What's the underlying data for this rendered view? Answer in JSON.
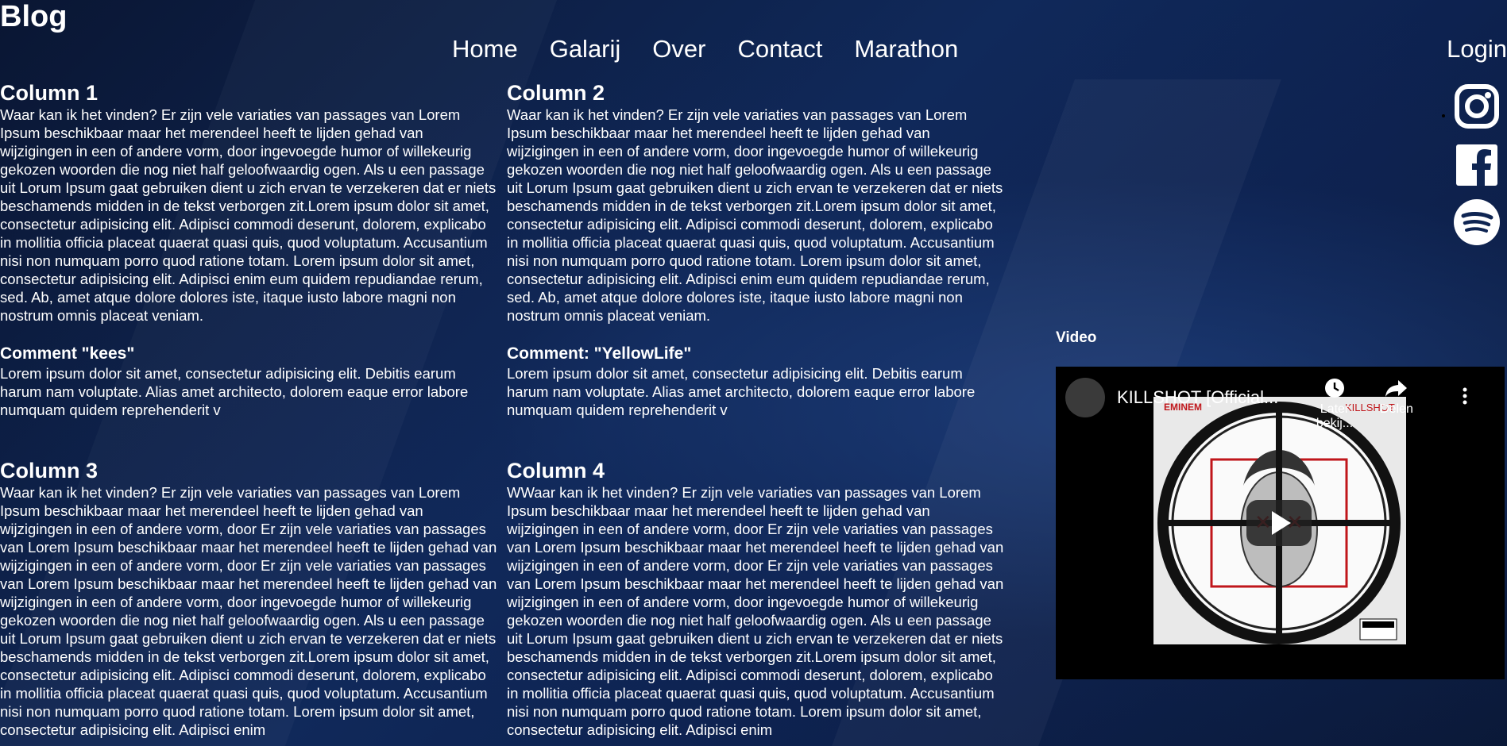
{
  "header": {
    "site_title": "Blog",
    "nav": [
      "Home",
      "Galarij",
      "Over",
      "Contact",
      "Marathon"
    ],
    "login": "Login"
  },
  "social": [
    {
      "icon": "instagram-icon"
    },
    {
      "icon": "facebook-icon"
    },
    {
      "icon": "spotify-icon"
    }
  ],
  "columns": [
    {
      "title": "Column 1",
      "text": "Waar kan ik het vinden? Er zijn vele variaties van passages van Lorem Ipsum beschikbaar maar het merendeel heeft te lijden gehad van wijzigingen in een of andere vorm, door ingevoegde humor of willekeurig gekozen woorden die nog niet half geloofwaardig ogen. Als u een passage uit Lorum Ipsum gaat gebruiken dient u zich ervan te verzekeren dat er niets beschamends midden in de tekst verborgen zit.Lorem ipsum dolor sit amet, consectetur adipisicing elit. Adipisci commodi deserunt, dolorem, explicabo in mollitia officia placeat quaerat quasi quis, quod voluptatum. Accusantium nisi non numquam porro quod ratione totam. Lorem ipsum dolor sit amet, consectetur adipisicing elit. Adipisci enim eum quidem repudiandae rerum, sed. Ab, amet atque dolore dolores iste, itaque iusto labore magni non nostrum omnis placeat veniam.",
      "comment_title": "Comment \"kees\"",
      "comment_text": "Lorem ipsum dolor sit amet, consectetur adipisicing elit. Debitis earum harum nam voluptate. Alias amet architecto, dolorem eaque error labore numquam quidem reprehenderit v"
    },
    {
      "title": "Column 2",
      "text": "Waar kan ik het vinden? Er zijn vele variaties van passages van Lorem Ipsum beschikbaar maar het merendeel heeft te lijden gehad van wijzigingen in een of andere vorm, door ingevoegde humor of willekeurig gekozen woorden die nog niet half geloofwaardig ogen. Als u een passage uit Lorum Ipsum gaat gebruiken dient u zich ervan te verzekeren dat er niets beschamends midden in de tekst verborgen zit.Lorem ipsum dolor sit amet, consectetur adipisicing elit. Adipisci commodi deserunt, dolorem, explicabo in mollitia officia placeat quaerat quasi quis, quod voluptatum. Accusantium nisi non numquam porro quod ratione totam. Lorem ipsum dolor sit amet, consectetur adipisicing elit. Adipisci enim eum quidem repudiandae rerum, sed. Ab, amet atque dolore dolores iste, itaque iusto labore magni non nostrum omnis placeat veniam.",
      "comment_title": "Comment: \"YellowLife\"",
      "comment_text": "Lorem ipsum dolor sit amet, consectetur adipisicing elit. Debitis earum harum nam voluptate. Alias amet architecto, dolorem eaque error labore numquam quidem reprehenderit v"
    },
    {
      "title": "Column 3",
      "text": "Waar kan ik het vinden? Er zijn vele variaties van passages van Lorem Ipsum beschikbaar maar het merendeel heeft te lijden gehad van wijzigingen in een of andere vorm, door Er zijn vele variaties van passages van Lorem Ipsum beschikbaar maar het merendeel heeft te lijden gehad van wijzigingen in een of andere vorm, door Er zijn vele variaties van passages van Lorem Ipsum beschikbaar maar het merendeel heeft te lijden gehad van wijzigingen in een of andere vorm, door ingevoegde humor of willekeurig gekozen woorden die nog niet half geloofwaardig ogen. Als u een passage uit Lorum Ipsum gaat gebruiken dient u zich ervan te verzekeren dat er niets beschamends midden in de tekst verborgen zit.Lorem ipsum dolor sit amet, consectetur adipisicing elit. Adipisci commodi deserunt, dolorem, explicabo in mollitia officia placeat quaerat quasi quis, quod voluptatum. Accusantium nisi non numquam porro quod ratione totam. Lorem ipsum dolor sit amet, consectetur adipisicing elit. Adipisci enim"
    },
    {
      "title": "Column 4",
      "text": "WWaar kan ik het vinden? Er zijn vele variaties van passages van Lorem Ipsum beschikbaar maar het merendeel heeft te lijden gehad van wijzigingen in een of andere vorm, door Er zijn vele variaties van passages van Lorem Ipsum beschikbaar maar het merendeel heeft te lijden gehad van wijzigingen in een of andere vorm, door Er zijn vele variaties van passages van Lorem Ipsum beschikbaar maar het merendeel heeft te lijden gehad van wijzigingen in een of andere vorm, door ingevoegde humor of willekeurig gekozen woorden die nog niet half geloofwaardig ogen. Als u een passage uit Lorum Ipsum gaat gebruiken dient u zich ervan te verzekeren dat er niets beschamends midden in de tekst verborgen zit.Lorem ipsum dolor sit amet, consectetur adipisicing elit. Adipisci commodi deserunt, dolorem, explicabo in mollitia officia placeat quaerat quasi quis, quod voluptatum. Accusantium nisi non numquam porro quod ratione totam. Lorem ipsum dolor sit amet, consectetur adipisicing elit. Adipisci enim"
    }
  ],
  "video": {
    "heading": "Video",
    "title": "KILLSHOT [Official...",
    "watch_later": "Later bekij...",
    "share": "Delen",
    "cover_text": "EMINEM",
    "cover_subtext": "KILLSHOT"
  }
}
